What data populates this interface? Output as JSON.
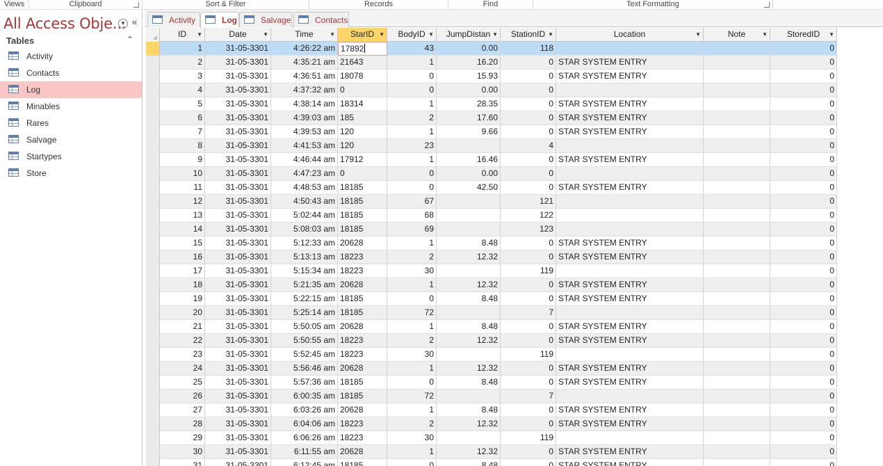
{
  "ribbon": {
    "groups": [
      "Views",
      "Clipboard",
      "Sort & Filter",
      "Records",
      "Find",
      "Text Formatting"
    ]
  },
  "nav": {
    "title": "All Access Obje...",
    "group_label": "Tables",
    "items": [
      {
        "label": "Activity"
      },
      {
        "label": "Contacts"
      },
      {
        "label": "Log",
        "selected": true
      },
      {
        "label": "Minables"
      },
      {
        "label": "Rares"
      },
      {
        "label": "Salvage"
      },
      {
        "label": "Startypes"
      },
      {
        "label": "Store"
      }
    ]
  },
  "tabs": [
    {
      "label": "Activity"
    },
    {
      "label": "Log",
      "active": true
    },
    {
      "label": "Salvage"
    },
    {
      "label": "Contacts"
    }
  ],
  "table": {
    "columns": [
      "ID",
      "Date",
      "Time",
      "StarID",
      "BodyID",
      "JumpDistan",
      "StationID",
      "Location",
      "Note",
      "StoredID"
    ],
    "active_column": "StarID",
    "editing_value": "17892",
    "rows": [
      [
        "1",
        "31-05-3301",
        "4:26:22 am",
        "17892",
        "43",
        "0.00",
        "118",
        "",
        "",
        "0"
      ],
      [
        "2",
        "31-05-3301",
        "4:35:21 am",
        "21643",
        "1",
        "16.20",
        "0",
        "STAR SYSTEM ENTRY",
        "",
        "0"
      ],
      [
        "3",
        "31-05-3301",
        "4:36:51 am",
        "18078",
        "0",
        "15.93",
        "0",
        "STAR SYSTEM ENTRY",
        "",
        "0"
      ],
      [
        "4",
        "31-05-3301",
        "4:37:32 am",
        "0",
        "0",
        "0.00",
        "0",
        "",
        "",
        "0"
      ],
      [
        "5",
        "31-05-3301",
        "4:38:14 am",
        "18314",
        "1",
        "28.35",
        "0",
        "STAR SYSTEM ENTRY",
        "",
        "0"
      ],
      [
        "6",
        "31-05-3301",
        "4:39:03 am",
        "185",
        "2",
        "17.60",
        "0",
        "STAR SYSTEM ENTRY",
        "",
        "0"
      ],
      [
        "7",
        "31-05-3301",
        "4:39:53 am",
        "120",
        "1",
        "9.66",
        "0",
        "STAR SYSTEM ENTRY",
        "",
        "0"
      ],
      [
        "8",
        "31-05-3301",
        "4:41:53 am",
        "120",
        "23",
        "",
        "4",
        "",
        "",
        "0"
      ],
      [
        "9",
        "31-05-3301",
        "4:46:44 am",
        "17912",
        "1",
        "16.46",
        "0",
        "STAR SYSTEM ENTRY",
        "",
        "0"
      ],
      [
        "10",
        "31-05-3301",
        "4:47:23 am",
        "0",
        "0",
        "0.00",
        "0",
        "",
        "",
        "0"
      ],
      [
        "11",
        "31-05-3301",
        "4:48:53 am",
        "18185",
        "0",
        "42.50",
        "0",
        "STAR SYSTEM ENTRY",
        "",
        "0"
      ],
      [
        "12",
        "31-05-3301",
        "4:50:43 am",
        "18185",
        "67",
        "",
        "121",
        "",
        "",
        "0"
      ],
      [
        "13",
        "31-05-3301",
        "5:02:44 am",
        "18185",
        "68",
        "",
        "122",
        "",
        "",
        "0"
      ],
      [
        "14",
        "31-05-3301",
        "5:08:03 am",
        "18185",
        "69",
        "",
        "123",
        "",
        "",
        "0"
      ],
      [
        "15",
        "31-05-3301",
        "5:12:33 am",
        "20628",
        "1",
        "8.48",
        "0",
        "STAR SYSTEM ENTRY",
        "",
        "0"
      ],
      [
        "16",
        "31-05-3301",
        "5:13:13 am",
        "18223",
        "2",
        "12.32",
        "0",
        "STAR SYSTEM ENTRY",
        "",
        "0"
      ],
      [
        "17",
        "31-05-3301",
        "5:15:34 am",
        "18223",
        "30",
        "",
        "119",
        "",
        "",
        "0"
      ],
      [
        "18",
        "31-05-3301",
        "5:21:35 am",
        "20628",
        "1",
        "12.32",
        "0",
        "STAR SYSTEM ENTRY",
        "",
        "0"
      ],
      [
        "19",
        "31-05-3301",
        "5:22:15 am",
        "18185",
        "0",
        "8.48",
        "0",
        "STAR SYSTEM ENTRY",
        "",
        "0"
      ],
      [
        "20",
        "31-05-3301",
        "5:25:14 am",
        "18185",
        "72",
        "",
        "7",
        "",
        "",
        "0"
      ],
      [
        "21",
        "31-05-3301",
        "5:50:05 am",
        "20628",
        "1",
        "8.48",
        "0",
        "STAR SYSTEM ENTRY",
        "",
        "0"
      ],
      [
        "22",
        "31-05-3301",
        "5:50:55 am",
        "18223",
        "2",
        "12.32",
        "0",
        "STAR SYSTEM ENTRY",
        "",
        "0"
      ],
      [
        "23",
        "31-05-3301",
        "5:52:45 am",
        "18223",
        "30",
        "",
        "119",
        "",
        "",
        "0"
      ],
      [
        "24",
        "31-05-3301",
        "5:56:46 am",
        "20628",
        "1",
        "12.32",
        "0",
        "STAR SYSTEM ENTRY",
        "",
        "0"
      ],
      [
        "25",
        "31-05-3301",
        "5:57:36 am",
        "18185",
        "0",
        "8.48",
        "0",
        "STAR SYSTEM ENTRY",
        "",
        "0"
      ],
      [
        "26",
        "31-05-3301",
        "6:00:35 am",
        "18185",
        "72",
        "",
        "7",
        "",
        "",
        "0"
      ],
      [
        "27",
        "31-05-3301",
        "6:03:26 am",
        "20628",
        "1",
        "8.48",
        "0",
        "STAR SYSTEM ENTRY",
        "",
        "0"
      ],
      [
        "28",
        "31-05-3301",
        "6:04:06 am",
        "18223",
        "2",
        "12.32",
        "0",
        "STAR SYSTEM ENTRY",
        "",
        "0"
      ],
      [
        "29",
        "31-05-3301",
        "6:06:26 am",
        "18223",
        "30",
        "",
        "119",
        "",
        "",
        "0"
      ],
      [
        "30",
        "31-05-3301",
        "6:11:55 am",
        "20628",
        "1",
        "12.32",
        "0",
        "STAR SYSTEM ENTRY",
        "",
        "0"
      ],
      [
        "31",
        "31-05-3301",
        "6:12:45 am",
        "18185",
        "0",
        "8.48",
        "0",
        "STAR SYSTEM ENTRY",
        "",
        "0"
      ]
    ]
  },
  "colors": {
    "title_red": "#a4373a",
    "selected_nav": "#f9c5c5",
    "current_row": "#bfdcf7",
    "active_header": "#fbd46a"
  }
}
